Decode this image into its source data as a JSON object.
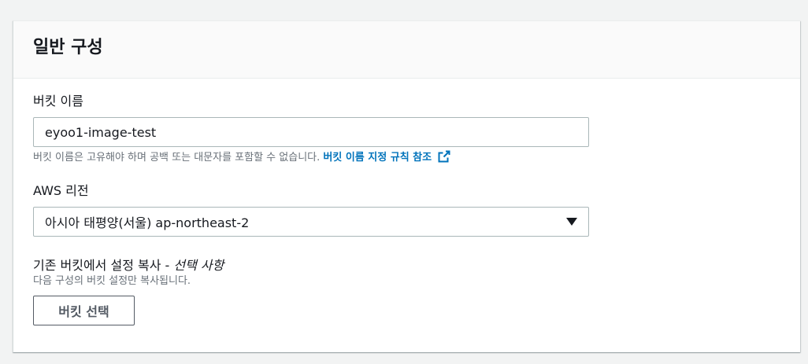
{
  "section": {
    "title": "일반 구성"
  },
  "bucket_name": {
    "label": "버킷 이름",
    "value": "eyoo1-image-test",
    "hint": "버킷 이름은 고유해야 하며 공백 또는 대문자를 포함할 수 없습니다.",
    "hint_link": "버킷 이름 지정 규칙 참조",
    "hint_link_icon": "external-link-icon"
  },
  "region": {
    "label": "AWS 리전",
    "selected": "아시아 태평양(서울) ap-northeast-2",
    "caret_icon": "caret-down-icon"
  },
  "copy_settings": {
    "label_main": "기존 버킷에서 설정 복사 - ",
    "label_optional": "선택 사항",
    "description": "다음 구성의 버킷 설정만 복사됩니다.",
    "button_label": "버킷 선택"
  },
  "colors": {
    "link": "#0073bb",
    "text": "#16191f",
    "muted": "#687078",
    "border": "#aab7b8",
    "button_border": "#545b64"
  }
}
